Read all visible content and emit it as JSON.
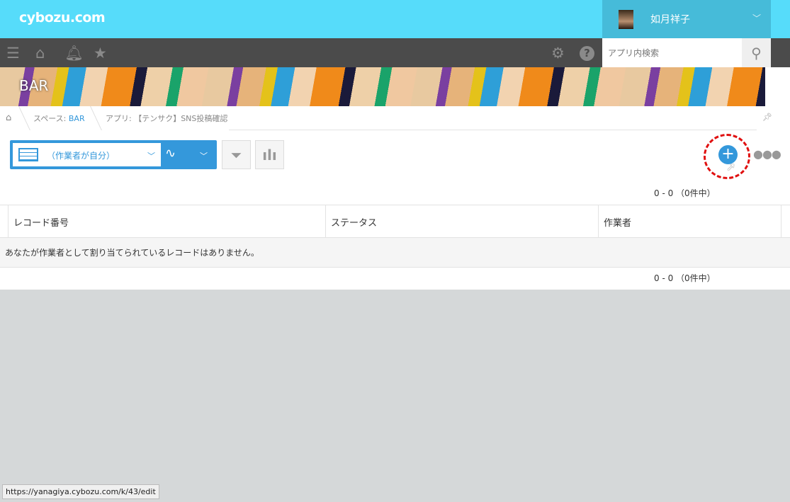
{
  "header": {
    "logo": "cybozu.com",
    "user_name": "如月祥子"
  },
  "search": {
    "placeholder": "アプリ内検索"
  },
  "banner": {
    "title": "BAR"
  },
  "breadcrumb": {
    "space_prefix": "スペース: ",
    "space": "BAR",
    "app": "アプリ: 【テンサク】SNS投稿確認"
  },
  "view": {
    "label": "（作業者が自分）"
  },
  "pager": {
    "top": "0 - 0 （0件中）",
    "bottom": "0 - 0 （0件中）"
  },
  "table": {
    "columns": [
      "レコード番号",
      "ステータス",
      "作業者"
    ],
    "empty_message": "あなたが作業者として割り当てられているレコードはありません。"
  },
  "statusbar": {
    "url": "https://yanagiya.cybozu.com/k/43/edit"
  },
  "colors": {
    "header": "#56dcfa",
    "accent": "#3498db",
    "nav": "#4b4b4b"
  }
}
